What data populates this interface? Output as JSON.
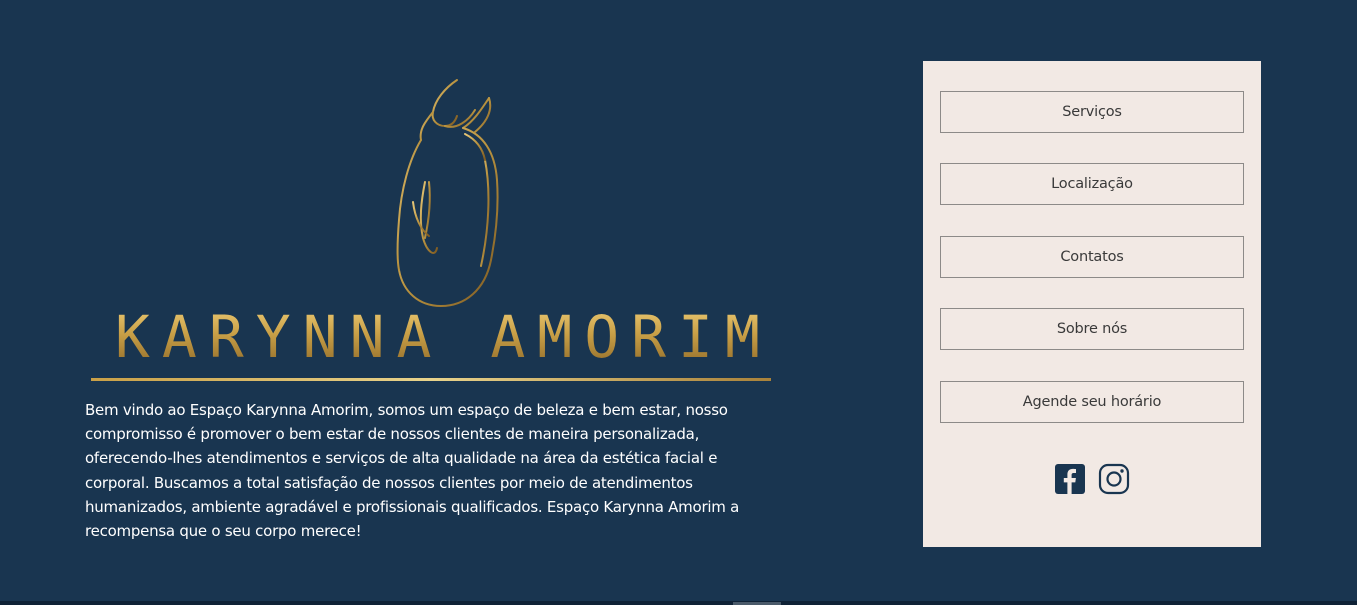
{
  "theme": {
    "background": "#193550",
    "panel_background": "#f2e9e4",
    "text_light": "#ffffff",
    "text_dark": "#3a3a3a",
    "icon_dark": "#193550",
    "gold": "#c9a047"
  },
  "brand": {
    "logo_text": "KARYNNA AMORIM"
  },
  "intro": {
    "text": "Bem vindo ao Espaço Karynna Amorim, somos um espaço de beleza e bem estar, nosso compromisso é promover o bem estar de nossos clientes de maneira personalizada, oferecendo-lhes atendimentos e serviços de alta qualidade na área da estética facial e corporal. Buscamos a total satisfação de nossos clientes por meio de atendimentos humanizados, ambiente agradável e profissionais qualificados. Espaço Karynna Amorim a recompensa que o seu corpo merece!"
  },
  "nav": {
    "items": [
      {
        "label": "Serviços"
      },
      {
        "label": "Localização"
      },
      {
        "label": "Contatos"
      },
      {
        "label": "Sobre nós"
      },
      {
        "label": "Agende seu horário"
      }
    ]
  },
  "social": {
    "icons": [
      "facebook-icon",
      "instagram-icon"
    ]
  }
}
